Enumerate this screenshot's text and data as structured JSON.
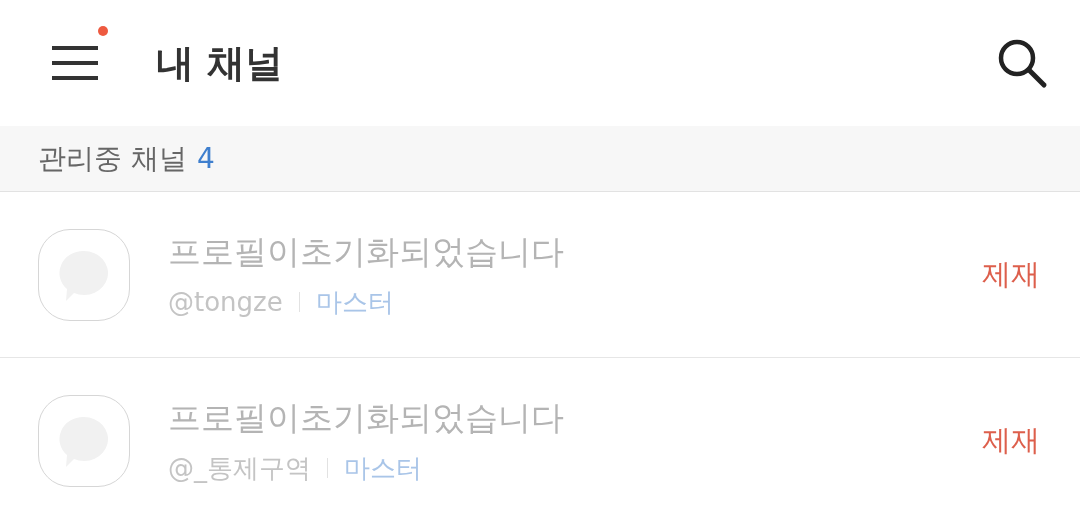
{
  "header": {
    "title": "내 채널",
    "menu_notification": true
  },
  "section": {
    "label": "관리중 채널",
    "count": "4"
  },
  "channels": [
    {
      "name": "프로필이초기화되었습니다",
      "handle": "@tongze",
      "role": "마스터",
      "action": "제재"
    },
    {
      "name": "프로필이초기화되었습니다",
      "handle": "@_통제구역",
      "role": "마스터",
      "action": "제재"
    }
  ]
}
